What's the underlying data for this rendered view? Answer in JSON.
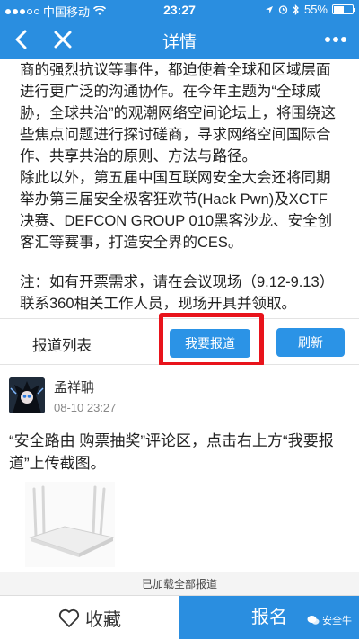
{
  "status_bar": {
    "carrier": "中国移动",
    "time": "23:27",
    "battery_text": "55%",
    "battery_level": 0.55
  },
  "nav": {
    "title": "详情"
  },
  "article": {
    "p1": "商的强烈抗议等事件，都迫使着全球和区域层面进行更广泛的沟通协作。在今年主题为“全球威胁，全球共治”的观潮网络空间论坛上，将围绕这些焦点问题进行探讨磋商，寻求网络空间国际合作、共享共治的原则、方法与路径。",
    "p2": "除此以外，第五届中国互联网安全大会还将同期举办第三届安全极客狂欢节(Hack Pwn)及XCTF决赛、DEFCON GROUP 010黑客沙龙、安全创客汇等赛事，打造安全界的CES。",
    "note": "注：如有开票需求，请在会议现场（9.12-9.13）联系360相关工作人员，现场开具并领取。"
  },
  "report_bar": {
    "title": "报道列表",
    "report_button": "我要报道",
    "refresh_button": "刷新"
  },
  "comment": {
    "author": "孟祥聃",
    "time": "08-10 23:27",
    "text": "“安全路由 购票抽奖”评论区，点击右上方“我要报道”上传截图。"
  },
  "footer_note": "已加载全部报道",
  "bottom_bar": {
    "favorite": "收藏",
    "signup": "报名"
  },
  "watermark": "安全牛",
  "colors": {
    "primary": "#2a8ee0",
    "highlight": "#e8131b"
  }
}
